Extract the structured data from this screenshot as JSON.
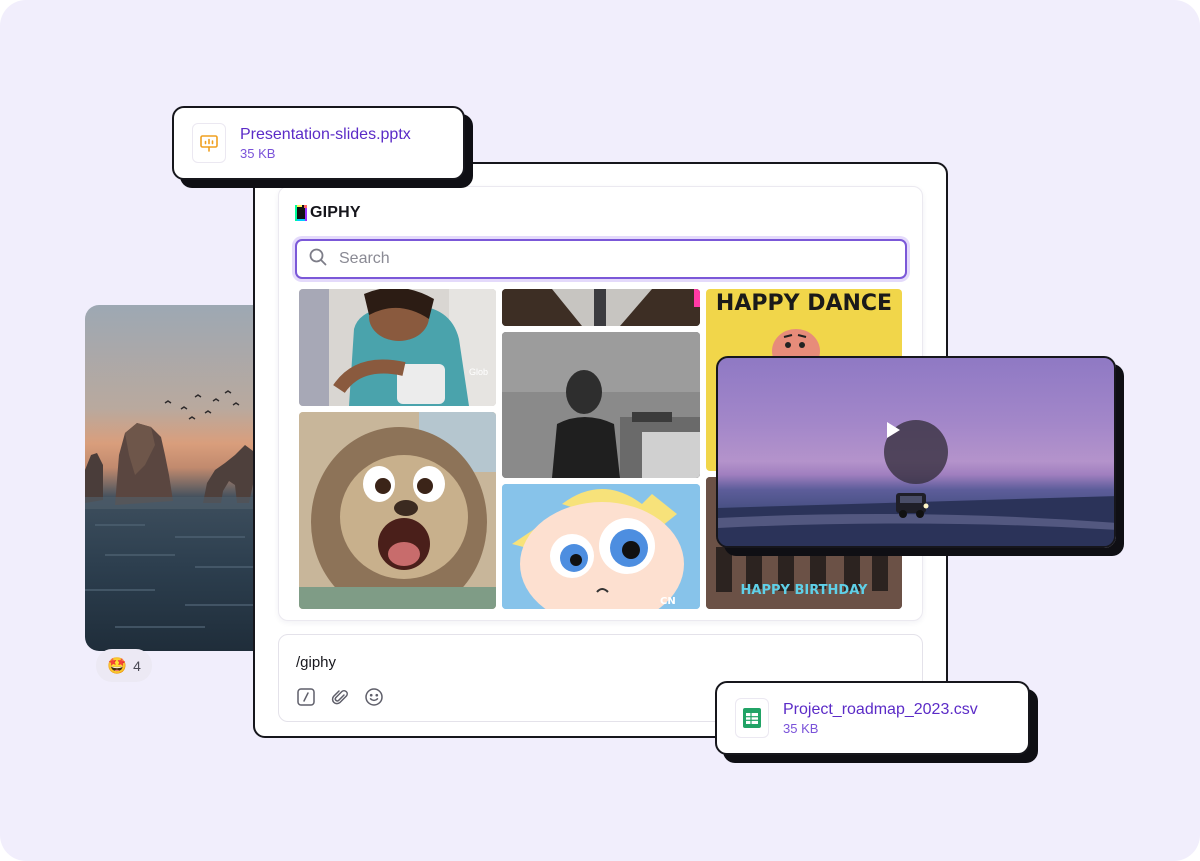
{
  "giphy": {
    "brand": "GIPHY",
    "search_placeholder": "Search",
    "gifs": [
      {
        "name": "woman-laughing",
        "caption": ""
      },
      {
        "name": "sloth-laughing",
        "caption": ""
      },
      {
        "name": "speaker-cropped",
        "caption": ""
      },
      {
        "name": "speaker-podium",
        "caption": ""
      },
      {
        "name": "powerpuff-crying",
        "caption": ""
      },
      {
        "name": "happy-dance",
        "caption": "HAPPY DANCE"
      },
      {
        "name": "happy-birthday",
        "caption": "HAPPY BIRTHDAY"
      }
    ],
    "watermark": "Glob",
    "channel_logo": "CN"
  },
  "composer": {
    "message": "/giphy",
    "tools": [
      "command-icon",
      "attachment-icon",
      "emoji-icon"
    ]
  },
  "reaction": {
    "emoji": "🤩",
    "count": "4"
  },
  "attachments": [
    {
      "file_name": "Presentation-slides.pptx",
      "size": "35 KB",
      "icon": "presentation-icon",
      "color": "#f5a623"
    },
    {
      "file_name": "Project_roadmap_2023.csv",
      "size": "35 KB",
      "icon": "spreadsheet-icon",
      "color": "#21a366"
    }
  ],
  "video": {
    "icon": "play-icon"
  },
  "colors": {
    "background": "#f1eefc",
    "accent": "#7b58d8",
    "file_text": "#5b2bc7",
    "border": "#16161c"
  }
}
